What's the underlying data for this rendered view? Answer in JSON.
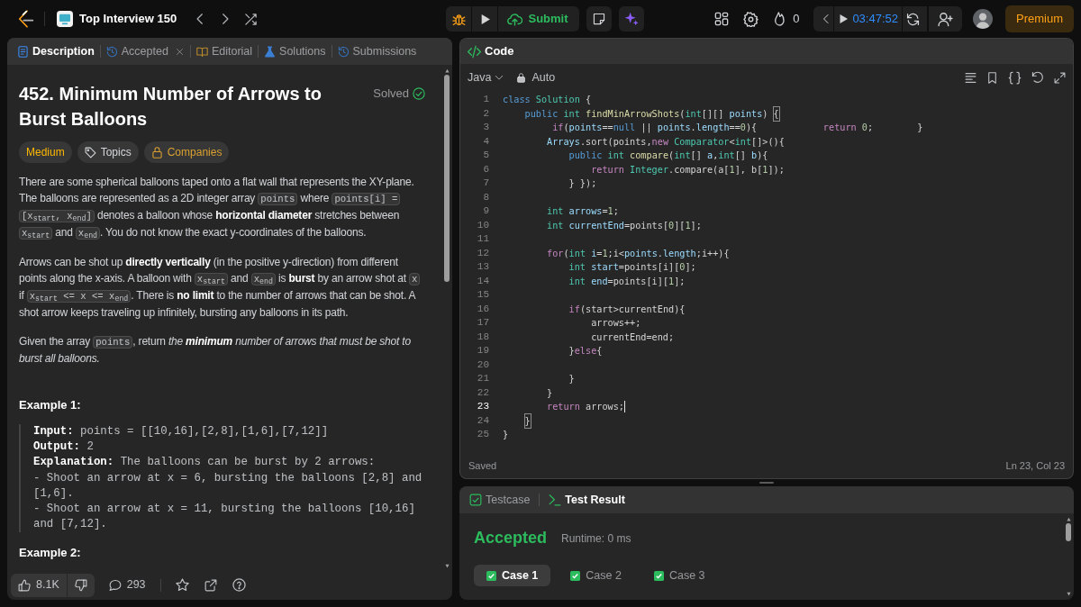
{
  "top_bar": {
    "list_title": "Top Interview 150",
    "submit_label": "Submit",
    "streak_count": "0",
    "timer": "03:47:52",
    "premium_label": "Premium"
  },
  "description_panel": {
    "tabs": [
      {
        "label": "Description",
        "kind": "description",
        "selected": true,
        "closable": false
      },
      {
        "label": "Accepted",
        "kind": "accepted",
        "selected": false,
        "closable": true
      },
      {
        "label": "Editorial",
        "kind": "editorial",
        "selected": false,
        "closable": false
      },
      {
        "label": "Solutions",
        "kind": "solutions",
        "selected": false,
        "closable": false
      },
      {
        "label": "Submissions",
        "kind": "submissions",
        "selected": false,
        "closable": false
      }
    ],
    "title": "452. Minimum Number of Arrows to Burst Balloons",
    "status": "Solved",
    "tags": [
      {
        "label": "Medium",
        "kind": "difficulty"
      },
      {
        "label": "Topics",
        "kind": "topics"
      },
      {
        "label": "Companies",
        "kind": "companies"
      }
    ],
    "paragraphs": [
      [
        {
          "kind": "text",
          "text": "There are some spherical balloons taped onto a flat wall that represents the XY-plane. The balloons are represented as a 2D integer array "
        },
        {
          "kind": "code",
          "text": "points"
        },
        {
          "kind": "text",
          "text": " where "
        },
        {
          "kind": "code",
          "text": "points[i] = [x$_{start}$, x$_{end}$]"
        },
        {
          "kind": "text",
          "text": " denotes a balloon whose **horizontal diameter** stretches between "
        },
        {
          "kind": "code",
          "text": "x$_{start}$"
        },
        {
          "kind": "text",
          "text": " and "
        },
        {
          "kind": "code",
          "text": "x$_{end}$"
        },
        {
          "kind": "text",
          "text": ". You do not know the exact y-coordinates of the balloons."
        }
      ],
      [
        {
          "kind": "text",
          "text": "Arrows can be shot up **directly vertically** (in the positive y-direction) from different points along the x-axis. A balloon with "
        },
        {
          "kind": "code",
          "text": "x$_{start}$"
        },
        {
          "kind": "text",
          "text": " and "
        },
        {
          "kind": "code",
          "text": "x$_{end}$"
        },
        {
          "kind": "text",
          "text": " is **burst** by an arrow shot at "
        },
        {
          "kind": "code",
          "text": "x"
        },
        {
          "kind": "text",
          "text": " if "
        },
        {
          "kind": "code",
          "text": "x$_{start}$ <= x <= x$_{end}$"
        },
        {
          "kind": "text",
          "text": ". There is **no limit** to the number of arrows that can be shot. A shot arrow keeps traveling up infinitely, bursting any balloons in its path."
        }
      ],
      [
        {
          "kind": "text",
          "text": "Given the array "
        },
        {
          "kind": "code",
          "text": "points"
        },
        {
          "kind": "text",
          "text": ", return "
        },
        {
          "kind": "em",
          "text": "the **minimum** number of arrows that must be shot to burst all balloons."
        }
      ]
    ],
    "examples": [
      {
        "heading": "Example 1:",
        "lines": [
          "**Input:** points = [[10,16],[2,8],[1,6],[7,12]]",
          "**Output:** 2",
          "**Explanation:** The balloons can be burst by 2 arrows:",
          "- Shoot an arrow at x = 6, bursting the balloons [2,8] and [1,6].",
          "- Shoot an arrow at x = 11, bursting the balloons [10,16] and [7,12]."
        ]
      },
      {
        "heading": "Example 2:"
      }
    ],
    "footer": {
      "likes": "8.1K",
      "comments": "293"
    }
  },
  "code_panel": {
    "title": "Code",
    "language": "Java",
    "mode": "Auto",
    "lines": [
      {
        "number": "1",
        "current": false,
        "tokens": [
          {
            "text": "class ",
            "kind": "keyword"
          },
          {
            "text": "Solution",
            "kind": "type"
          },
          {
            "text": " {",
            "kind": "plain"
          }
        ]
      },
      {
        "number": "2",
        "current": false,
        "tokens": [
          {
            "text": "    public ",
            "kind": "keyword"
          },
          {
            "text": "int ",
            "kind": "type"
          },
          {
            "text": "findMinArrowShots",
            "kind": "function"
          },
          {
            "text": "(",
            "kind": "plain"
          },
          {
            "text": "int",
            "kind": "type"
          },
          {
            "text": "[][] ",
            "kind": "plain"
          },
          {
            "text": "points",
            "kind": "variable"
          },
          {
            "text": ") ",
            "kind": "plain"
          },
          {
            "text": "{",
            "kind": "match"
          }
        ]
      },
      {
        "number": "3",
        "current": false,
        "tokens": [
          {
            "text": "         if",
            "kind": "control"
          },
          {
            "text": "(",
            "kind": "plain"
          },
          {
            "text": "points",
            "kind": "variable"
          },
          {
            "text": "==",
            "kind": "plain"
          },
          {
            "text": "null",
            "kind": "keyword"
          },
          {
            "text": " || ",
            "kind": "plain"
          },
          {
            "text": "points",
            "kind": "variable"
          },
          {
            "text": ".",
            "kind": "plain"
          },
          {
            "text": "length",
            "kind": "variable"
          },
          {
            "text": "==",
            "kind": "plain"
          },
          {
            "text": "0",
            "kind": "number"
          },
          {
            "text": "){            ",
            "kind": "plain"
          },
          {
            "text": "return ",
            "kind": "control"
          },
          {
            "text": "0",
            "kind": "number"
          },
          {
            "text": ";        }",
            "kind": "plain"
          }
        ]
      },
      {
        "number": "4",
        "current": false,
        "tokens": [
          {
            "text": "        Arrays",
            "kind": "variable"
          },
          {
            "text": ".sort(points,",
            "kind": "plain"
          },
          {
            "text": "new ",
            "kind": "control"
          },
          {
            "text": "Comparator",
            "kind": "type"
          },
          {
            "text": "<",
            "kind": "plain"
          },
          {
            "text": "int",
            "kind": "type"
          },
          {
            "text": "[]>(){",
            "kind": "plain"
          }
        ]
      },
      {
        "number": "5",
        "current": false,
        "tokens": [
          {
            "text": "            public ",
            "kind": "keyword"
          },
          {
            "text": "int ",
            "kind": "type"
          },
          {
            "text": "compare",
            "kind": "function"
          },
          {
            "text": "(",
            "kind": "plain"
          },
          {
            "text": "int",
            "kind": "type"
          },
          {
            "text": "[] ",
            "kind": "plain"
          },
          {
            "text": "a",
            "kind": "variable"
          },
          {
            "text": ",",
            "kind": "plain"
          },
          {
            "text": "int",
            "kind": "type"
          },
          {
            "text": "[] ",
            "kind": "plain"
          },
          {
            "text": "b",
            "kind": "variable"
          },
          {
            "text": "){",
            "kind": "plain"
          }
        ]
      },
      {
        "number": "6",
        "current": false,
        "tokens": [
          {
            "text": "                return ",
            "kind": "control"
          },
          {
            "text": "Integer",
            "kind": "type"
          },
          {
            "text": ".compare(a[",
            "kind": "plain"
          },
          {
            "text": "1",
            "kind": "number"
          },
          {
            "text": "], b[",
            "kind": "plain"
          },
          {
            "text": "1",
            "kind": "number"
          },
          {
            "text": "]);",
            "kind": "plain"
          }
        ]
      },
      {
        "number": "7",
        "current": false,
        "tokens": [
          {
            "text": "            } });",
            "kind": "plain"
          }
        ]
      },
      {
        "number": "8",
        "current": false
      },
      {
        "number": "9",
        "current": false,
        "tokens": [
          {
            "text": "        int ",
            "kind": "type"
          },
          {
            "text": "arrows",
            "kind": "variable"
          },
          {
            "text": "=",
            "kind": "plain"
          },
          {
            "text": "1",
            "kind": "number"
          },
          {
            "text": ";",
            "kind": "plain"
          }
        ]
      },
      {
        "number": "10",
        "current": false,
        "tokens": [
          {
            "text": "        int ",
            "kind": "type"
          },
          {
            "text": "currentEnd",
            "kind": "variable"
          },
          {
            "text": "=points[",
            "kind": "plain"
          },
          {
            "text": "0",
            "kind": "number"
          },
          {
            "text": "][",
            "kind": "plain"
          },
          {
            "text": "1",
            "kind": "number"
          },
          {
            "text": "];",
            "kind": "plain"
          }
        ]
      },
      {
        "number": "11",
        "current": false
      },
      {
        "number": "12",
        "current": false,
        "tokens": [
          {
            "text": "        for",
            "kind": "control"
          },
          {
            "text": "(",
            "kind": "plain"
          },
          {
            "text": "int ",
            "kind": "type"
          },
          {
            "text": "i",
            "kind": "variable"
          },
          {
            "text": "=",
            "kind": "plain"
          },
          {
            "text": "1",
            "kind": "number"
          },
          {
            "text": ";i<",
            "kind": "plain"
          },
          {
            "text": "points",
            "kind": "variable"
          },
          {
            "text": ".",
            "kind": "plain"
          },
          {
            "text": "length",
            "kind": "variable"
          },
          {
            "text": ";i++){",
            "kind": "plain"
          }
        ]
      },
      {
        "number": "13",
        "current": false,
        "tokens": [
          {
            "text": "            int ",
            "kind": "type"
          },
          {
            "text": "start",
            "kind": "variable"
          },
          {
            "text": "=points[i][",
            "kind": "plain"
          },
          {
            "text": "0",
            "kind": "number"
          },
          {
            "text": "];",
            "kind": "plain"
          }
        ]
      },
      {
        "number": "14",
        "current": false,
        "tokens": [
          {
            "text": "            int ",
            "kind": "type"
          },
          {
            "text": "end",
            "kind": "variable"
          },
          {
            "text": "=points[i][",
            "kind": "plain"
          },
          {
            "text": "1",
            "kind": "number"
          },
          {
            "text": "];",
            "kind": "plain"
          }
        ]
      },
      {
        "number": "15",
        "current": false
      },
      {
        "number": "16",
        "current": false,
        "tokens": [
          {
            "text": "            if",
            "kind": "control"
          },
          {
            "text": "(start>currentEnd){",
            "kind": "plain"
          }
        ]
      },
      {
        "number": "17",
        "current": false,
        "tokens": [
          {
            "text": "                arrows++;",
            "kind": "plain"
          }
        ]
      },
      {
        "number": "18",
        "current": false,
        "tokens": [
          {
            "text": "                currentEnd=end;",
            "kind": "plain"
          }
        ]
      },
      {
        "number": "19",
        "current": false,
        "tokens": [
          {
            "text": "            }",
            "kind": "plain"
          },
          {
            "text": "else",
            "kind": "control"
          },
          {
            "text": "{",
            "kind": "plain"
          }
        ]
      },
      {
        "number": "20",
        "current": false
      },
      {
        "number": "21",
        "current": false,
        "tokens": [
          {
            "text": "            }",
            "kind": "plain"
          }
        ]
      },
      {
        "number": "22",
        "current": false,
        "tokens": [
          {
            "text": "        }",
            "kind": "plain"
          }
        ]
      },
      {
        "number": "23",
        "current": true,
        "tokens": [
          {
            "text": "        return ",
            "kind": "control"
          },
          {
            "text": "arrows;",
            "kind": "plain"
          }
        ]
      },
      {
        "number": "24",
        "current": false,
        "tokens": [
          {
            "text": "    }",
            "kind": "match"
          }
        ]
      },
      {
        "number": "25",
        "current": false,
        "tokens": [
          {
            "text": "}",
            "kind": "plain"
          }
        ]
      }
    ],
    "save_status": "Saved",
    "cursor_position": "Ln 23, Col 23"
  },
  "test_panel": {
    "tabs": [
      {
        "label": "Testcase",
        "kind": "testcase",
        "selected": false
      },
      {
        "label": "Test Result",
        "kind": "result",
        "selected": true
      }
    ],
    "verdict": "Accepted",
    "runtime": "Runtime: 0 ms",
    "cases": [
      {
        "label": "Case 1",
        "selected": true,
        "passed": true
      },
      {
        "label": "Case 2",
        "selected": false,
        "passed": true
      },
      {
        "label": "Case 3",
        "selected": false,
        "passed": true
      }
    ]
  }
}
